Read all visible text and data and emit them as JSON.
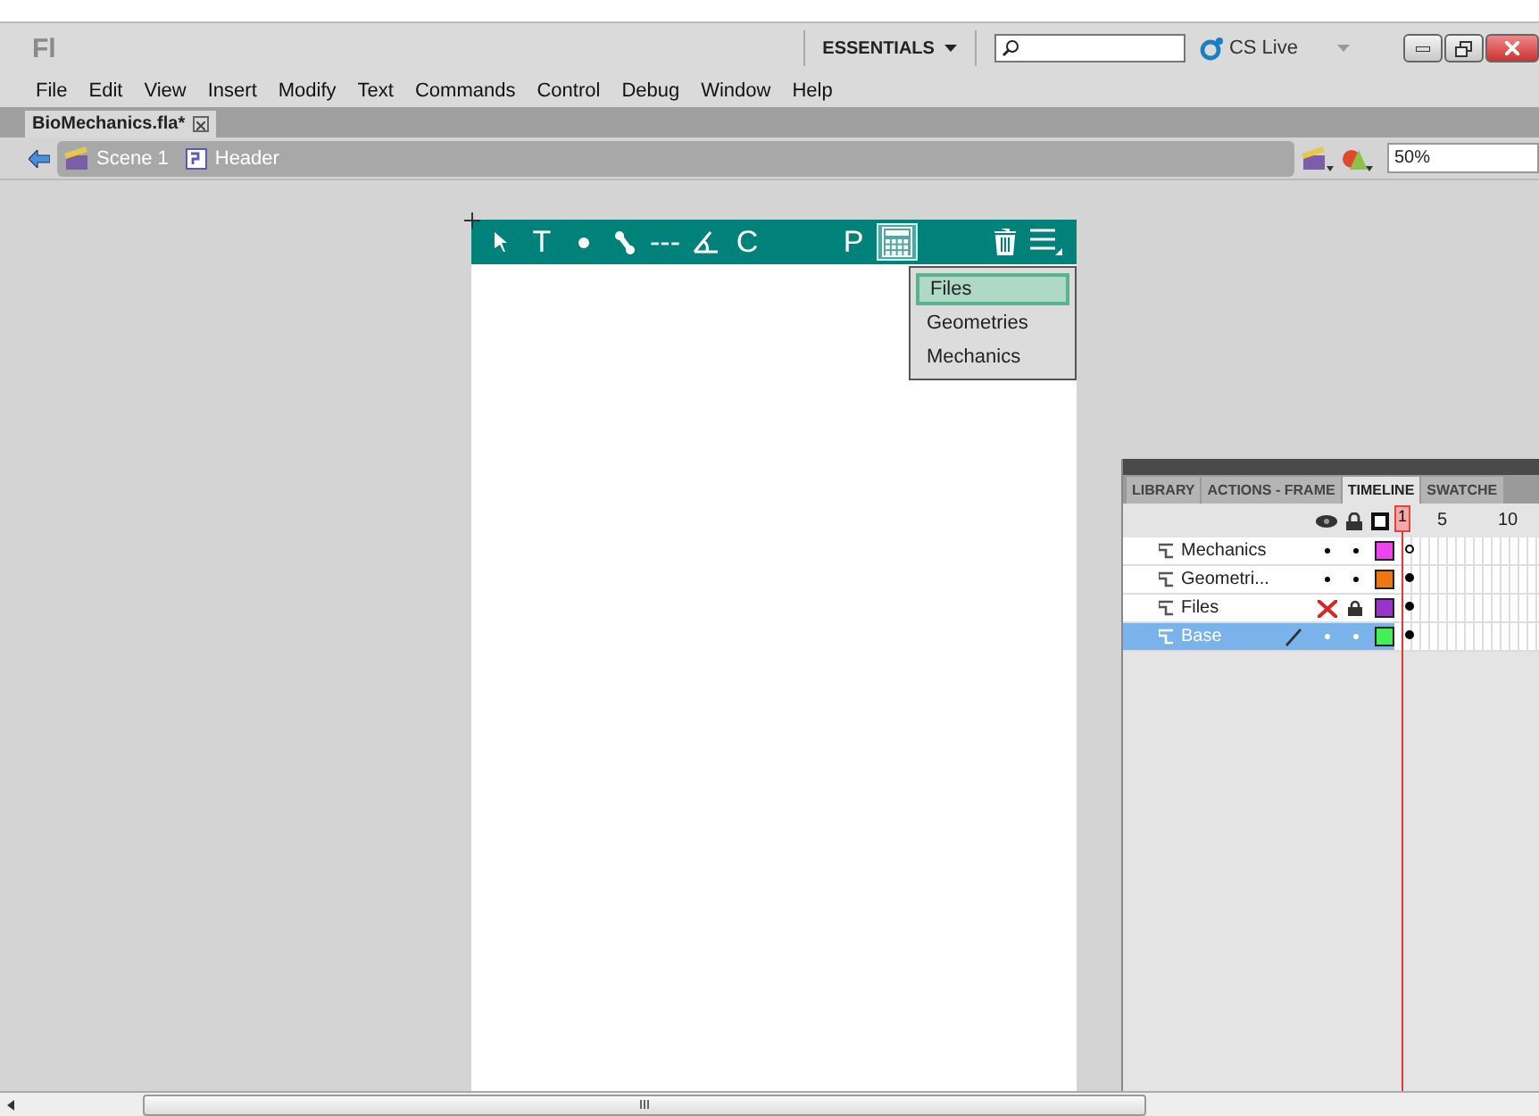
{
  "title_bar": {
    "logo": "Fl",
    "workspace": "ESSENTIALS",
    "cs_live": "CS Live"
  },
  "menu": [
    "File",
    "Edit",
    "View",
    "Insert",
    "Modify",
    "Text",
    "Commands",
    "Control",
    "Debug",
    "Window",
    "Help"
  ],
  "document_tab": {
    "title": "BioMechanics.fla*"
  },
  "breadcrumbs": [
    {
      "kind": "scene",
      "label": "Scene 1"
    },
    {
      "kind": "symbol",
      "label": "Header"
    }
  ],
  "zoom": "50%",
  "toolbar": [
    {
      "kind": "pointer",
      "selected": false
    },
    {
      "kind": "text",
      "label": "T",
      "selected": false
    },
    {
      "kind": "dot",
      "selected": false
    },
    {
      "kind": "bone",
      "selected": false
    },
    {
      "kind": "text",
      "label": "---",
      "selected": false
    },
    {
      "kind": "angle",
      "selected": false
    },
    {
      "kind": "text",
      "label": "C",
      "selected": false
    },
    {
      "kind": "gap"
    },
    {
      "kind": "text",
      "label": "P",
      "selected": false
    },
    {
      "kind": "grid",
      "selected": true
    },
    {
      "kind": "gap"
    },
    {
      "kind": "trash",
      "selected": false
    },
    {
      "kind": "menu",
      "selected": false
    }
  ],
  "dropdown": [
    {
      "label": "Files",
      "selected": true
    },
    {
      "label": "Geometries",
      "selected": false
    },
    {
      "label": "Mechanics",
      "selected": false
    }
  ],
  "timeline_panel": {
    "tabs": [
      {
        "label": "LIBRARY",
        "selected": false
      },
      {
        "label": "ACTIONS - FRAME",
        "selected": false
      },
      {
        "label": "TIMELINE",
        "selected": true
      },
      {
        "label": "SWATCHE",
        "selected": false
      }
    ],
    "frame_numbers": [
      "1",
      "5",
      "10"
    ],
    "layers": [
      {
        "name": "Mechanics",
        "hidden": false,
        "locked": false,
        "color": "#ee44ee",
        "selected": false,
        "editing": false,
        "keyframe_filled": false
      },
      {
        "name": "Geometri...",
        "hidden": false,
        "locked": false,
        "color": "#ee7711",
        "selected": false,
        "editing": false,
        "keyframe_filled": true
      },
      {
        "name": "Files",
        "hidden": true,
        "locked": true,
        "color": "#9933cc",
        "selected": false,
        "editing": false,
        "keyframe_filled": true
      },
      {
        "name": "Base",
        "hidden": false,
        "locked": false,
        "color": "#44ee55",
        "selected": true,
        "editing": true,
        "keyframe_filled": true
      }
    ]
  }
}
